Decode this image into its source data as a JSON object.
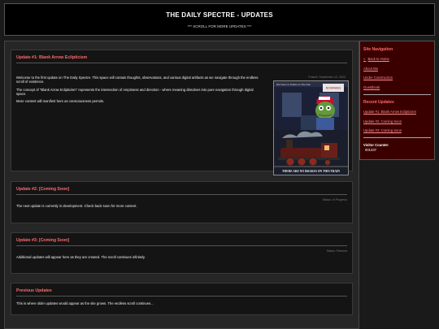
{
  "header": {
    "title": "THE DAILY SPECTRE - UPDATES",
    "subtitle": "*** SCROLL FOR MORE UPDATES ***"
  },
  "updates": [
    {
      "title": "Update #1: Blank Arrow Eclipticism",
      "meta": "Posted: September 12, 2023",
      "paragraphs": [
        "Welcome to the first update on The Daily Spectre. This space will contain thoughts, observations, and various digital artifacts as we navigate through the endless scroll of existence.",
        "The concept of \"Blank Arrow Eclipticism\" represents the intersection of emptiness and direction - where meaning dissolves into pure navigation through digital space.",
        "More content will manifest here as consciousness permits."
      ],
      "image_caption_top": "We have no brakes on this train",
      "image_sign": "NO BRAKES",
      "image_caption": "THERE ARE NO BRAKES ON THIS TRAIN"
    },
    {
      "title": "Update #2: [Coming Soon]",
      "meta": "Status: In Progress",
      "paragraphs": [
        "The next update is currently in development. Check back soon for more content."
      ]
    },
    {
      "title": "Update #3: [Coming Soon]",
      "meta": "Status: Planned",
      "paragraphs": [
        "Additional updates will appear here as they are created. The scroll continues infinitely."
      ]
    },
    {
      "title": "Previous Updates",
      "paragraphs": [
        "This is where older updates would appear as the site grows. The endless scroll continues..."
      ]
    }
  ],
  "sidebar": {
    "nav_title": "Site Navigation",
    "nav_home": "Back to Home",
    "nav_items": [
      "About Me",
      "Under Construction",
      "Guestbook"
    ],
    "recent_title": "Recent Updates",
    "recent_items": [
      "Update #1: Blank Arrow Eclipticism",
      "Update #2: Coming Soon",
      "Update #3: Coming Soon"
    ],
    "counter_label": "Visitor Counter:",
    "counter_value": "001337"
  },
  "colors": {
    "accent": "#ff6a6a",
    "sidebar_bg": "#3a0000",
    "page_bg": "#1a1a1a"
  }
}
